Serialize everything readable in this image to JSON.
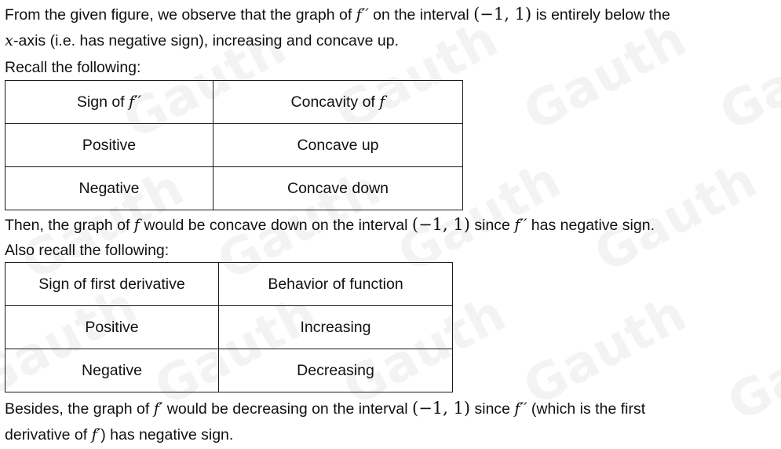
{
  "watermark": {
    "text": "Gauth",
    "color": "#f3f3f3"
  },
  "intro": {
    "line1_a": "From the given figure, we observe that the graph of ",
    "line1_fpp": "f′′",
    "line1_b": " on the interval ",
    "line1_interval": "(−1, 1)",
    "line1_c": " is entirely below the",
    "line2_x": "x",
    "line2_rest": "-axis (i.e. has negative sign), increasing and concave up.",
    "line3": "Recall the following:"
  },
  "table1": {
    "headers": [
      {
        "text": "Sign of ",
        "math": "f′′"
      },
      {
        "text": "Concavity of ",
        "math": "f"
      }
    ],
    "rows": [
      [
        "Positive",
        "Concave up"
      ],
      [
        "Negative",
        "Concave down"
      ]
    ]
  },
  "middle": {
    "line1_a": "Then, the graph of ",
    "line1_f": "f",
    "line1_b": " would be concave down on the interval ",
    "line1_interval": "(−1, 1)",
    "line1_c": " since ",
    "line1_fpp": "f′′",
    "line1_d": " has negative sign.",
    "line2": "Also recall the following:"
  },
  "table2": {
    "headers": [
      "Sign of first derivative",
      "Behavior of function"
    ],
    "rows": [
      [
        "Positive",
        "Increasing"
      ],
      [
        "Negative",
        "Decreasing"
      ]
    ]
  },
  "conclusion": {
    "line1_a": "Besides, the graph of ",
    "line1_fp": "f′",
    "line1_b": " would be decreasing on the interval ",
    "line1_interval": "(−1, 1)",
    "line1_c": " since ",
    "line1_fpp": "f′′",
    "line1_d": " (which is the first",
    "line2_a": "derivative of ",
    "line2_fp": "f′",
    "line2_b": ") has negative sign."
  }
}
